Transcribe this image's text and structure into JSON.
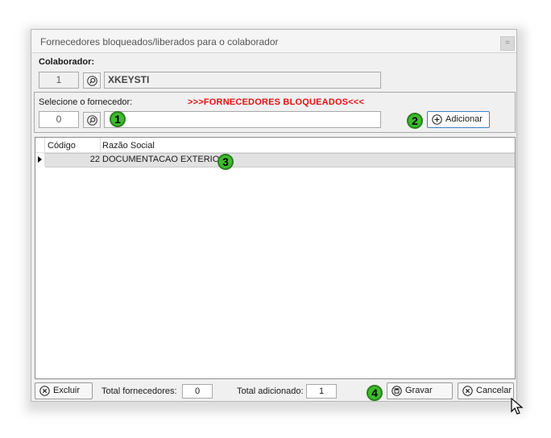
{
  "window": {
    "title": "Fornecedores bloqueados/liberados para o colaborador",
    "minimize_glyph": "="
  },
  "colaborador": {
    "label": "Colaborador:",
    "code": "1",
    "name": "XKEYSTI"
  },
  "fornecedor": {
    "label": "Selecione o fornecedor:",
    "code": "0",
    "name": "",
    "status_text": ">>>FORNECEDORES BLOQUEADOS<<<"
  },
  "buttons": {
    "add": "Adicionar",
    "delete": "Excluir",
    "save": "Gravar",
    "cancel": "Cancelar"
  },
  "grid": {
    "columns": [
      "Código",
      "Razão Social"
    ],
    "rows": [
      {
        "codigo": "22",
        "razao": "DOCUMENTACAO EXTERIOR"
      }
    ]
  },
  "totals": {
    "fornecedores_label": "Total fornecedores:",
    "fornecedores_value": "0",
    "adicionado_label": "Total adicionado:",
    "adicionado_value": "1"
  },
  "markers": [
    "1",
    "2",
    "3",
    "4"
  ],
  "icons": {
    "search": "magnifier-icon",
    "add": "plus-circle-icon",
    "delete": "x-circle-icon",
    "save": "disk-icon",
    "cancel": "x-circle-icon"
  },
  "colors": {
    "status_red": "#e01010",
    "marker_green": "#3dbb2e",
    "focus_blue": "#3f7fc7"
  }
}
